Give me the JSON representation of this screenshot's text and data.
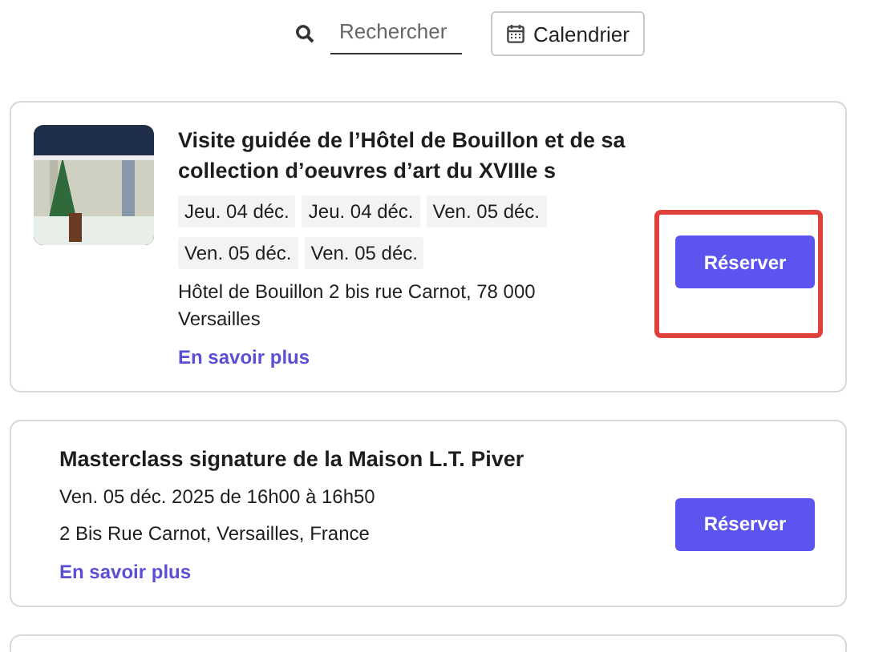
{
  "search": {
    "placeholder": "Rechercher"
  },
  "calendar_button": {
    "label": "Calendrier"
  },
  "events": [
    {
      "kind": "multi",
      "has_image": true,
      "title": "Visite guidée de l’Hôtel de Bouillon et de sa collection d’oeuvres d’art du XVIIIe s",
      "dates": [
        "Jeu. 04 déc.",
        "Jeu. 04 déc.",
        "Ven. 05 déc.",
        "Ven. 05 déc.",
        "Ven. 05 déc."
      ],
      "address": "Hôtel de Bouillon 2 bis rue Carnot, 78 000 Versailles",
      "link": "En savoir plus",
      "button": "Réserver",
      "highlighted": true
    },
    {
      "kind": "single",
      "has_image": false,
      "title": "Masterclass signature de la Maison L.T. Piver",
      "date": "Ven. 05 déc. 2025 de 16h00 à 16h50",
      "address": "2 Bis Rue Carnot, Versailles, France",
      "link": "En savoir plus",
      "button": "Réserver",
      "highlighted": false
    },
    {
      "kind": "empty"
    }
  ]
}
